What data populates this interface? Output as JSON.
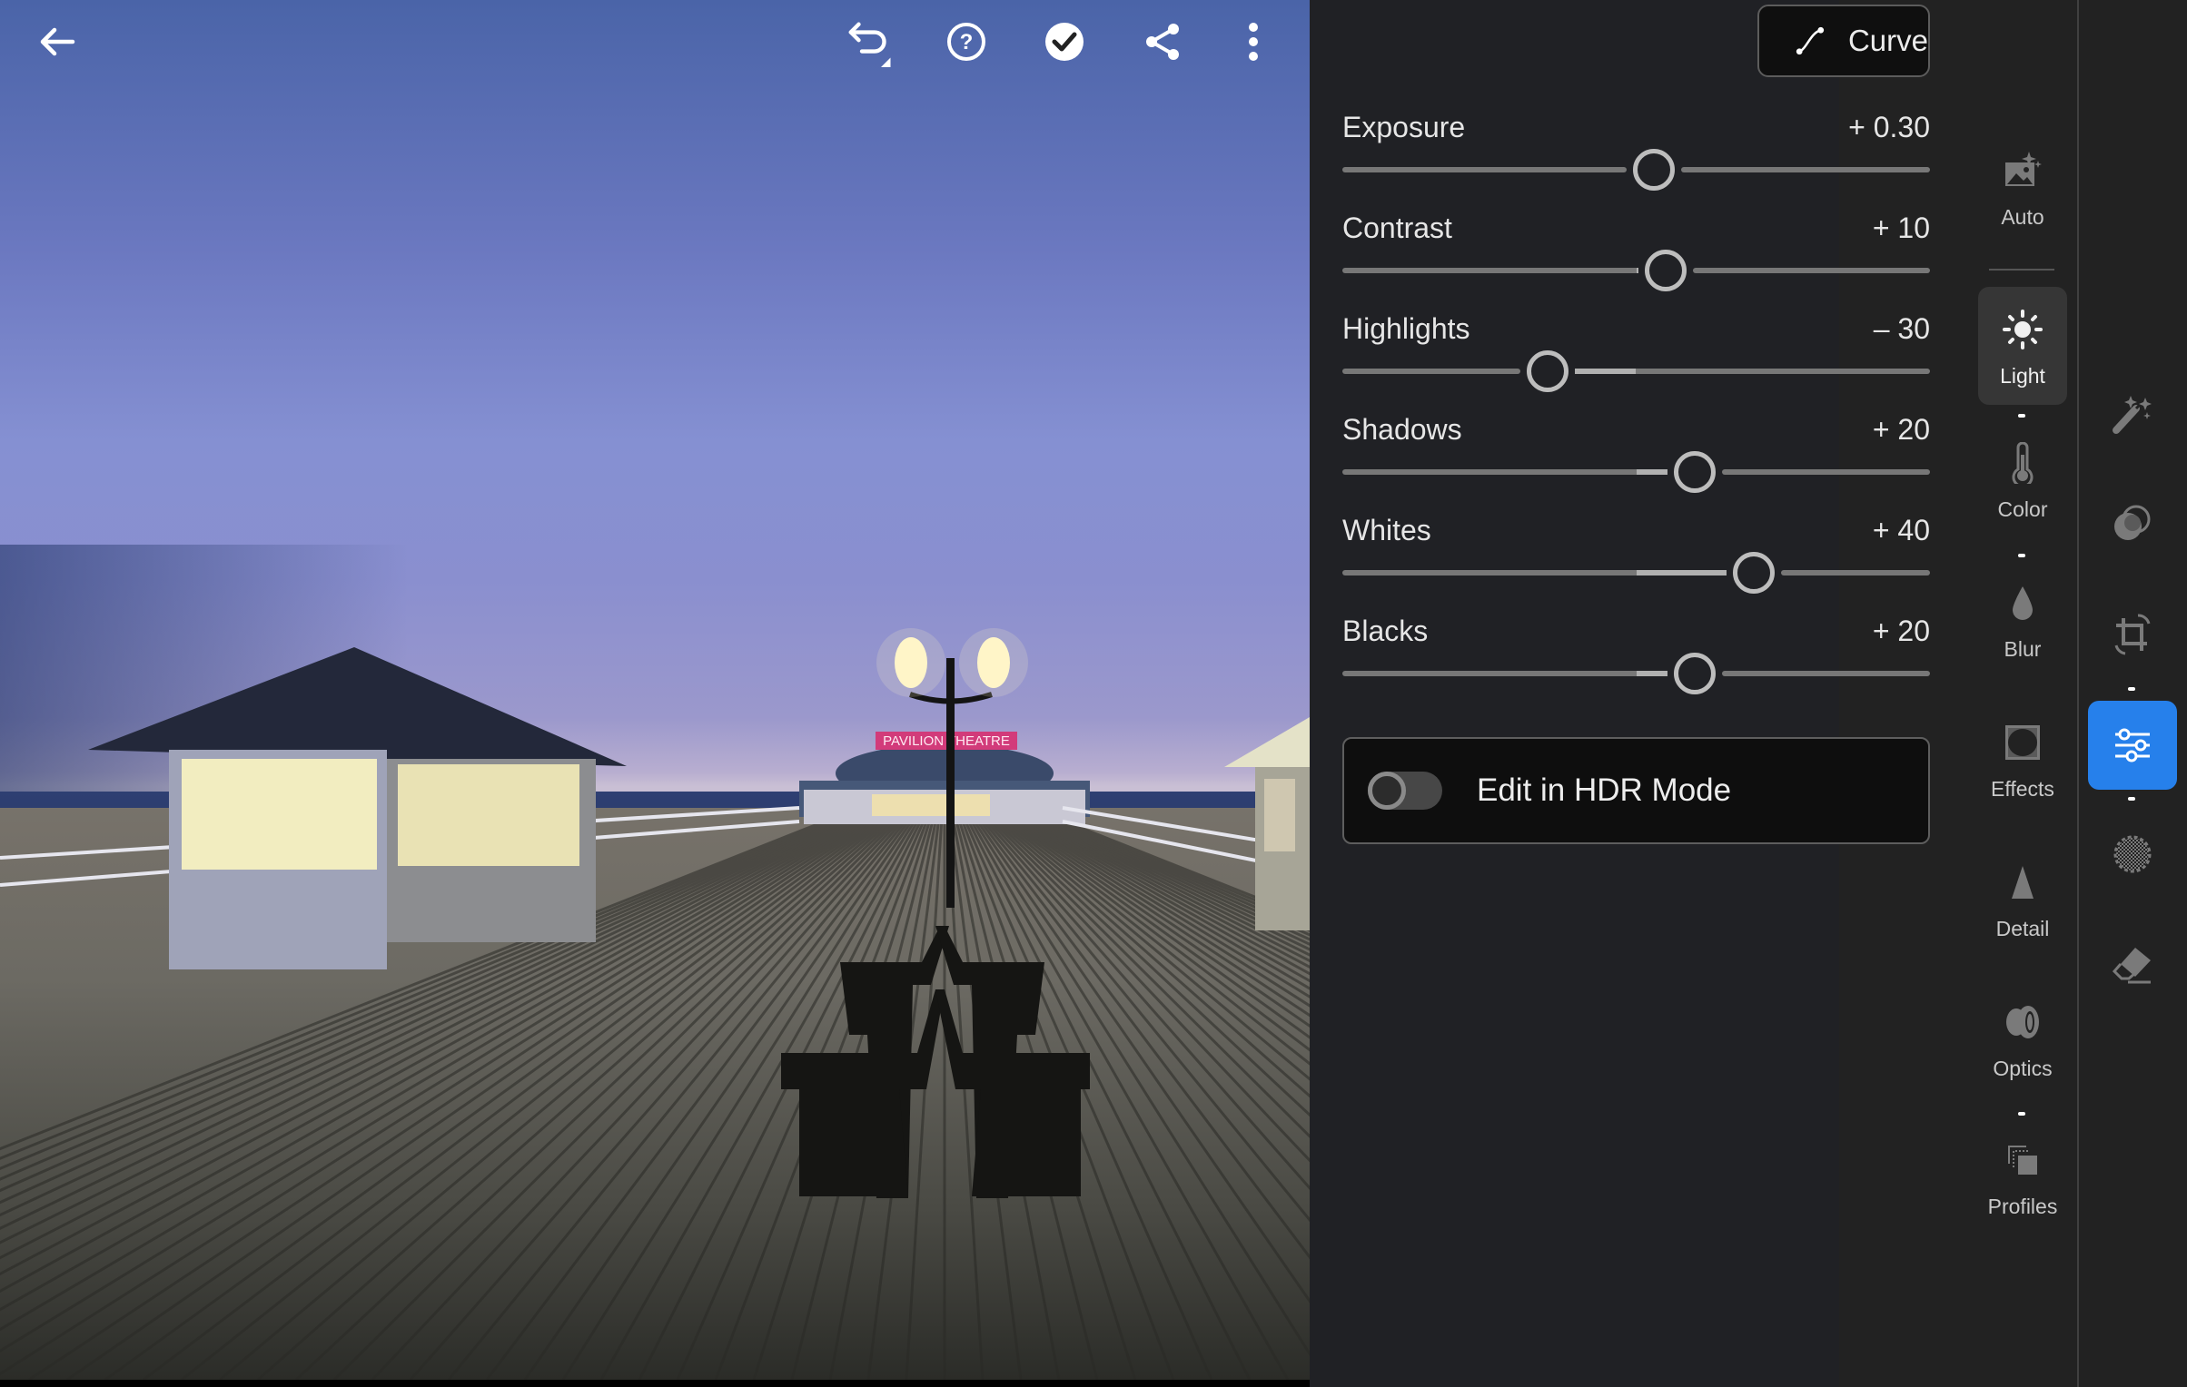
{
  "photo": {
    "description": "Pier at dusk with shelters, twin lamp post, benches and theatre",
    "sign_text": "PAVILION THEATRE"
  },
  "toolbar": {
    "back": "back-arrow-icon",
    "undo": "undo-icon",
    "help": "help-icon",
    "done": "checkmark-icon",
    "share": "share-icon",
    "more": "more-vertical-icon"
  },
  "panel": {
    "curve_label": "Curve",
    "sliders": [
      {
        "label": "Exposure",
        "value": "+ 0.30",
        "numeric": 0.3,
        "min": -5,
        "max": 5
      },
      {
        "label": "Contrast",
        "value": "+ 10",
        "numeric": 10,
        "min": -100,
        "max": 100
      },
      {
        "label": "Highlights",
        "value": "– 30",
        "numeric": -30,
        "min": -100,
        "max": 100
      },
      {
        "label": "Shadows",
        "value": "+ 20",
        "numeric": 20,
        "min": -100,
        "max": 100
      },
      {
        "label": "Whites",
        "value": "+ 40",
        "numeric": 40,
        "min": -100,
        "max": 100
      },
      {
        "label": "Blacks",
        "value": "+ 20",
        "numeric": 20,
        "min": -100,
        "max": 100
      }
    ],
    "hdr": {
      "label": "Edit in HDR Mode",
      "enabled": false
    }
  },
  "tools": [
    {
      "label": "Auto",
      "icon": "auto-enhance-icon",
      "active": false
    },
    {
      "label": "Light",
      "icon": "sun-icon",
      "active": true
    },
    {
      "label": "Color",
      "icon": "thermometer-icon",
      "active": false
    },
    {
      "label": "Blur",
      "icon": "droplet-icon",
      "active": false
    },
    {
      "label": "Effects",
      "icon": "vignette-icon",
      "active": false
    },
    {
      "label": "Detail",
      "icon": "triangle-icon",
      "active": false
    },
    {
      "label": "Optics",
      "icon": "lens-icon",
      "active": false
    },
    {
      "label": "Profiles",
      "icon": "profiles-icon",
      "active": false
    }
  ],
  "rail": [
    {
      "name": "presets",
      "icon": "magic-wand-icon",
      "active": false
    },
    {
      "name": "masking",
      "icon": "masking-icon",
      "active": false
    },
    {
      "name": "crop",
      "icon": "crop-rotate-icon",
      "active": false
    },
    {
      "name": "edit",
      "icon": "sliders-icon",
      "active": true
    },
    {
      "name": "healing",
      "icon": "healing-icon",
      "active": false
    },
    {
      "name": "remove",
      "icon": "eraser-icon",
      "active": false
    }
  ],
  "colors": {
    "accent": "#2680eb",
    "panel": "#222222",
    "active_tool_bg": "#363636"
  }
}
